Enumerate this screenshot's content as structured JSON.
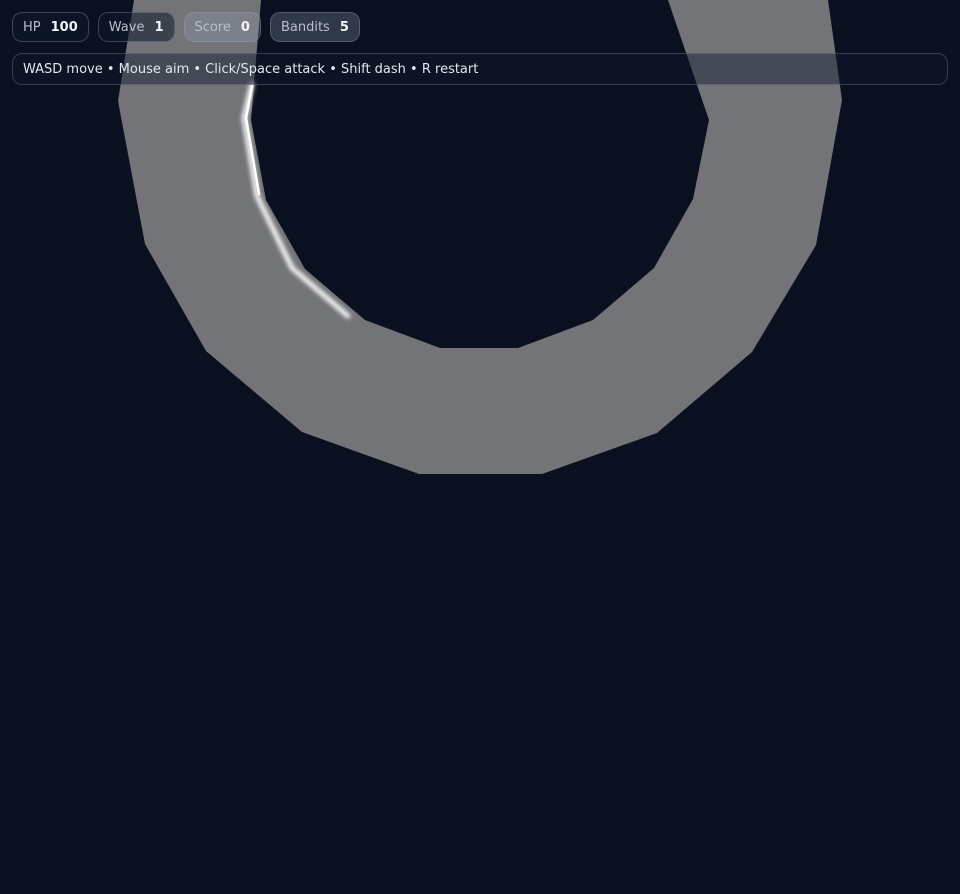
{
  "hud": {
    "stats": [
      {
        "label": "HP",
        "value": "100"
      },
      {
        "label": "Wave",
        "value": "1"
      },
      {
        "label": "Score",
        "value": "0"
      },
      {
        "label": "Bandits",
        "value": "5"
      }
    ],
    "help": "WASD move • Mouse aim • Click/Space attack • Shift dash • R restart"
  },
  "colors": {
    "background": "#0b1020",
    "arena_ring": "#727478",
    "slash_highlight": "#ffffff"
  }
}
